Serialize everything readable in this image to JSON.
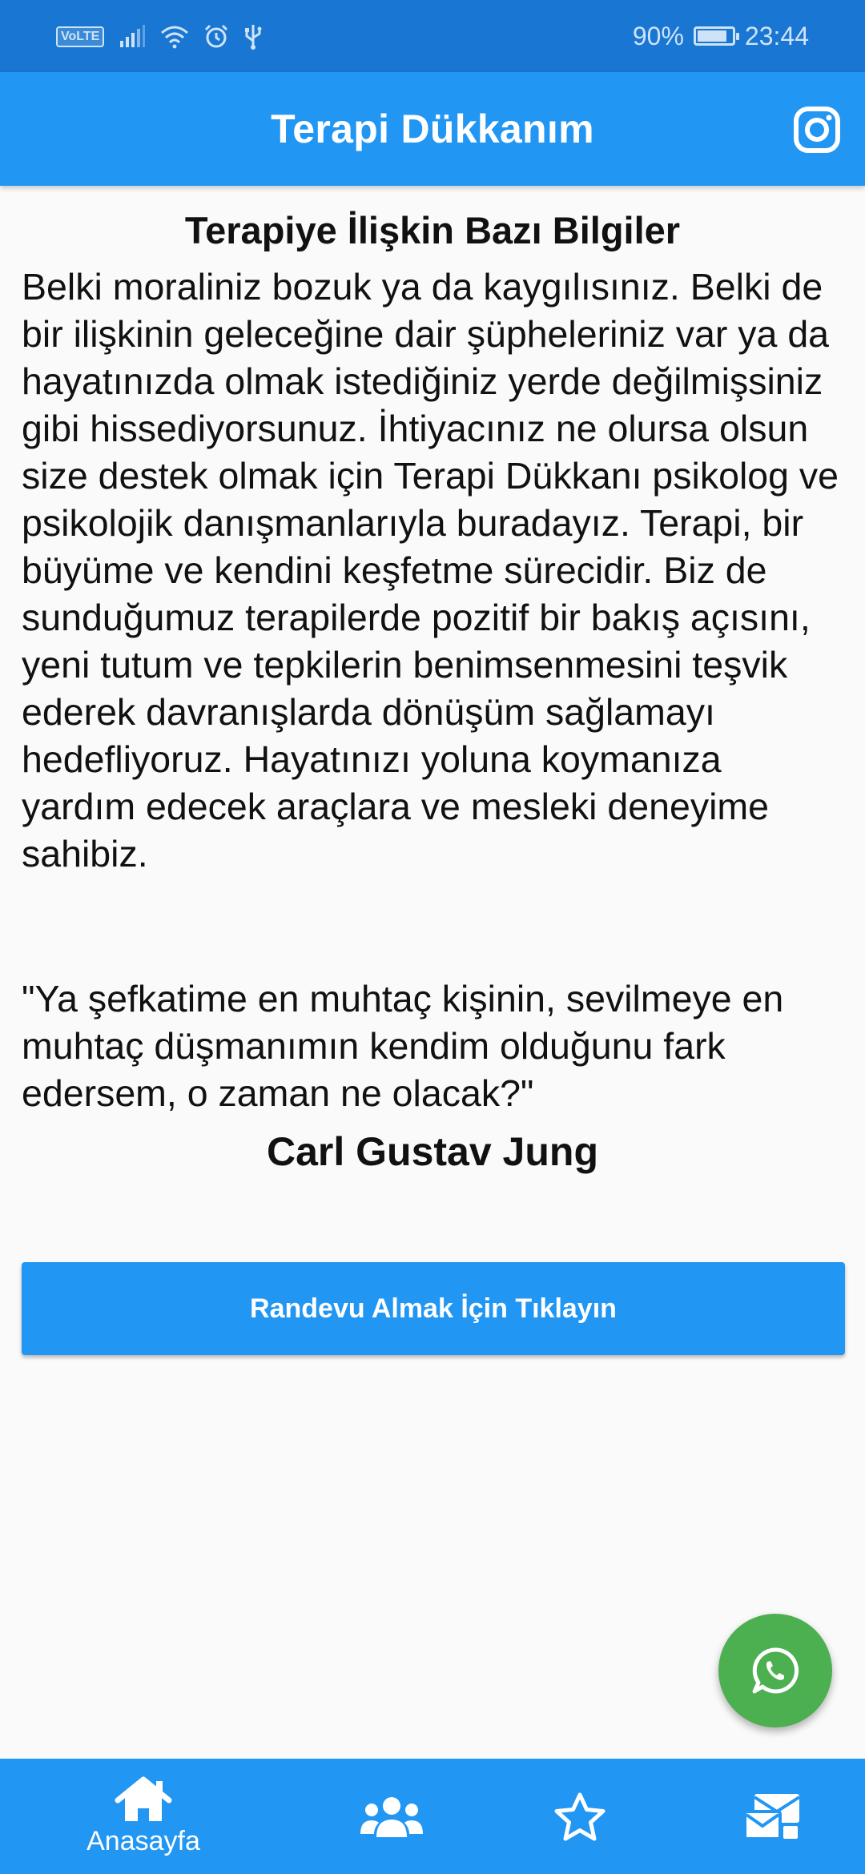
{
  "status_bar": {
    "volte": "VoLTE",
    "battery_percent": "90%",
    "battery_level": 0.9,
    "time": "23:44",
    "icons": [
      "volte-icon",
      "signal-icon",
      "wifi-icon",
      "alarm-icon",
      "usb-icon",
      "battery-charging-icon"
    ]
  },
  "app_bar": {
    "title": "Terapi Dükkanım",
    "action_icon": "instagram-icon"
  },
  "content": {
    "section_title": "Terapiye İlişkin Bazı Bilgiler",
    "body": "Belki moraliniz bozuk ya da kaygılısınız. Belki de bir ilişkinin geleceğine dair şüpheleriniz var ya da hayatınızda olmak istediğiniz yerde değilmişsiniz gibi hissediyorsunuz. İhtiyacınız ne olursa olsun size destek olmak için Terapi Dükkanı psikolog ve psikolojik danışmanlarıyla buradayız. Terapi, bir büyüme ve kendini keşfetme sürecidir. Biz de sunduğumuz terapilerde pozitif bir bakış açısını, yeni tutum ve tepkilerin benimsenmesini teşvik ederek davranışlarda dönüşüm sağlamayı hedefliyoruz. Hayatınızı yoluna koymanıza yardım edecek araçlara ve mesleki deneyime sahibiz.",
    "quote": "\"Ya şefkatime en muhtaç kişinin, sevilmeye en muhtaç düşmanımın kendim olduğunu fark edersem, o zaman ne olacak?\"",
    "quote_author": "Carl Gustav Jung"
  },
  "cta": {
    "label": "Randevu Almak İçin Tıklayın"
  },
  "fab": {
    "icon": "whatsapp-icon"
  },
  "bottom_nav": {
    "items": [
      {
        "label": "Anasayfa",
        "icon": "home-icon",
        "active": true
      },
      {
        "label": "",
        "icon": "users-icon",
        "active": false
      },
      {
        "label": "",
        "icon": "star-icon",
        "active": false
      },
      {
        "label": "",
        "icon": "contact-icon",
        "active": false
      }
    ]
  },
  "colors": {
    "status_bar": "#1976d2",
    "primary": "#2196f3",
    "fab": "#4caf50",
    "background": "#fafafa",
    "text": "#111111"
  }
}
